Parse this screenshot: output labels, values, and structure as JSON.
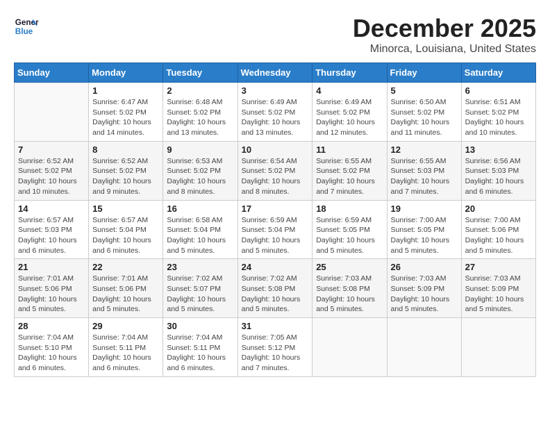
{
  "header": {
    "logo_line1": "General",
    "logo_line2": "Blue",
    "month": "December 2025",
    "location": "Minorca, Louisiana, United States"
  },
  "weekdays": [
    "Sunday",
    "Monday",
    "Tuesday",
    "Wednesday",
    "Thursday",
    "Friday",
    "Saturday"
  ],
  "weeks": [
    [
      {
        "day": "",
        "info": ""
      },
      {
        "day": "1",
        "info": "Sunrise: 6:47 AM\nSunset: 5:02 PM\nDaylight: 10 hours\nand 14 minutes."
      },
      {
        "day": "2",
        "info": "Sunrise: 6:48 AM\nSunset: 5:02 PM\nDaylight: 10 hours\nand 13 minutes."
      },
      {
        "day": "3",
        "info": "Sunrise: 6:49 AM\nSunset: 5:02 PM\nDaylight: 10 hours\nand 13 minutes."
      },
      {
        "day": "4",
        "info": "Sunrise: 6:49 AM\nSunset: 5:02 PM\nDaylight: 10 hours\nand 12 minutes."
      },
      {
        "day": "5",
        "info": "Sunrise: 6:50 AM\nSunset: 5:02 PM\nDaylight: 10 hours\nand 11 minutes."
      },
      {
        "day": "6",
        "info": "Sunrise: 6:51 AM\nSunset: 5:02 PM\nDaylight: 10 hours\nand 10 minutes."
      }
    ],
    [
      {
        "day": "7",
        "info": "Sunrise: 6:52 AM\nSunset: 5:02 PM\nDaylight: 10 hours\nand 10 minutes."
      },
      {
        "day": "8",
        "info": "Sunrise: 6:52 AM\nSunset: 5:02 PM\nDaylight: 10 hours\nand 9 minutes."
      },
      {
        "day": "9",
        "info": "Sunrise: 6:53 AM\nSunset: 5:02 PM\nDaylight: 10 hours\nand 8 minutes."
      },
      {
        "day": "10",
        "info": "Sunrise: 6:54 AM\nSunset: 5:02 PM\nDaylight: 10 hours\nand 8 minutes."
      },
      {
        "day": "11",
        "info": "Sunrise: 6:55 AM\nSunset: 5:02 PM\nDaylight: 10 hours\nand 7 minutes."
      },
      {
        "day": "12",
        "info": "Sunrise: 6:55 AM\nSunset: 5:03 PM\nDaylight: 10 hours\nand 7 minutes."
      },
      {
        "day": "13",
        "info": "Sunrise: 6:56 AM\nSunset: 5:03 PM\nDaylight: 10 hours\nand 6 minutes."
      }
    ],
    [
      {
        "day": "14",
        "info": "Sunrise: 6:57 AM\nSunset: 5:03 PM\nDaylight: 10 hours\nand 6 minutes."
      },
      {
        "day": "15",
        "info": "Sunrise: 6:57 AM\nSunset: 5:04 PM\nDaylight: 10 hours\nand 6 minutes."
      },
      {
        "day": "16",
        "info": "Sunrise: 6:58 AM\nSunset: 5:04 PM\nDaylight: 10 hours\nand 5 minutes."
      },
      {
        "day": "17",
        "info": "Sunrise: 6:59 AM\nSunset: 5:04 PM\nDaylight: 10 hours\nand 5 minutes."
      },
      {
        "day": "18",
        "info": "Sunrise: 6:59 AM\nSunset: 5:05 PM\nDaylight: 10 hours\nand 5 minutes."
      },
      {
        "day": "19",
        "info": "Sunrise: 7:00 AM\nSunset: 5:05 PM\nDaylight: 10 hours\nand 5 minutes."
      },
      {
        "day": "20",
        "info": "Sunrise: 7:00 AM\nSunset: 5:06 PM\nDaylight: 10 hours\nand 5 minutes."
      }
    ],
    [
      {
        "day": "21",
        "info": "Sunrise: 7:01 AM\nSunset: 5:06 PM\nDaylight: 10 hours\nand 5 minutes."
      },
      {
        "day": "22",
        "info": "Sunrise: 7:01 AM\nSunset: 5:06 PM\nDaylight: 10 hours\nand 5 minutes."
      },
      {
        "day": "23",
        "info": "Sunrise: 7:02 AM\nSunset: 5:07 PM\nDaylight: 10 hours\nand 5 minutes."
      },
      {
        "day": "24",
        "info": "Sunrise: 7:02 AM\nSunset: 5:08 PM\nDaylight: 10 hours\nand 5 minutes."
      },
      {
        "day": "25",
        "info": "Sunrise: 7:03 AM\nSunset: 5:08 PM\nDaylight: 10 hours\nand 5 minutes."
      },
      {
        "day": "26",
        "info": "Sunrise: 7:03 AM\nSunset: 5:09 PM\nDaylight: 10 hours\nand 5 minutes."
      },
      {
        "day": "27",
        "info": "Sunrise: 7:03 AM\nSunset: 5:09 PM\nDaylight: 10 hours\nand 5 minutes."
      }
    ],
    [
      {
        "day": "28",
        "info": "Sunrise: 7:04 AM\nSunset: 5:10 PM\nDaylight: 10 hours\nand 6 minutes."
      },
      {
        "day": "29",
        "info": "Sunrise: 7:04 AM\nSunset: 5:11 PM\nDaylight: 10 hours\nand 6 minutes."
      },
      {
        "day": "30",
        "info": "Sunrise: 7:04 AM\nSunset: 5:11 PM\nDaylight: 10 hours\nand 6 minutes."
      },
      {
        "day": "31",
        "info": "Sunrise: 7:05 AM\nSunset: 5:12 PM\nDaylight: 10 hours\nand 7 minutes."
      },
      {
        "day": "",
        "info": ""
      },
      {
        "day": "",
        "info": ""
      },
      {
        "day": "",
        "info": ""
      }
    ]
  ]
}
